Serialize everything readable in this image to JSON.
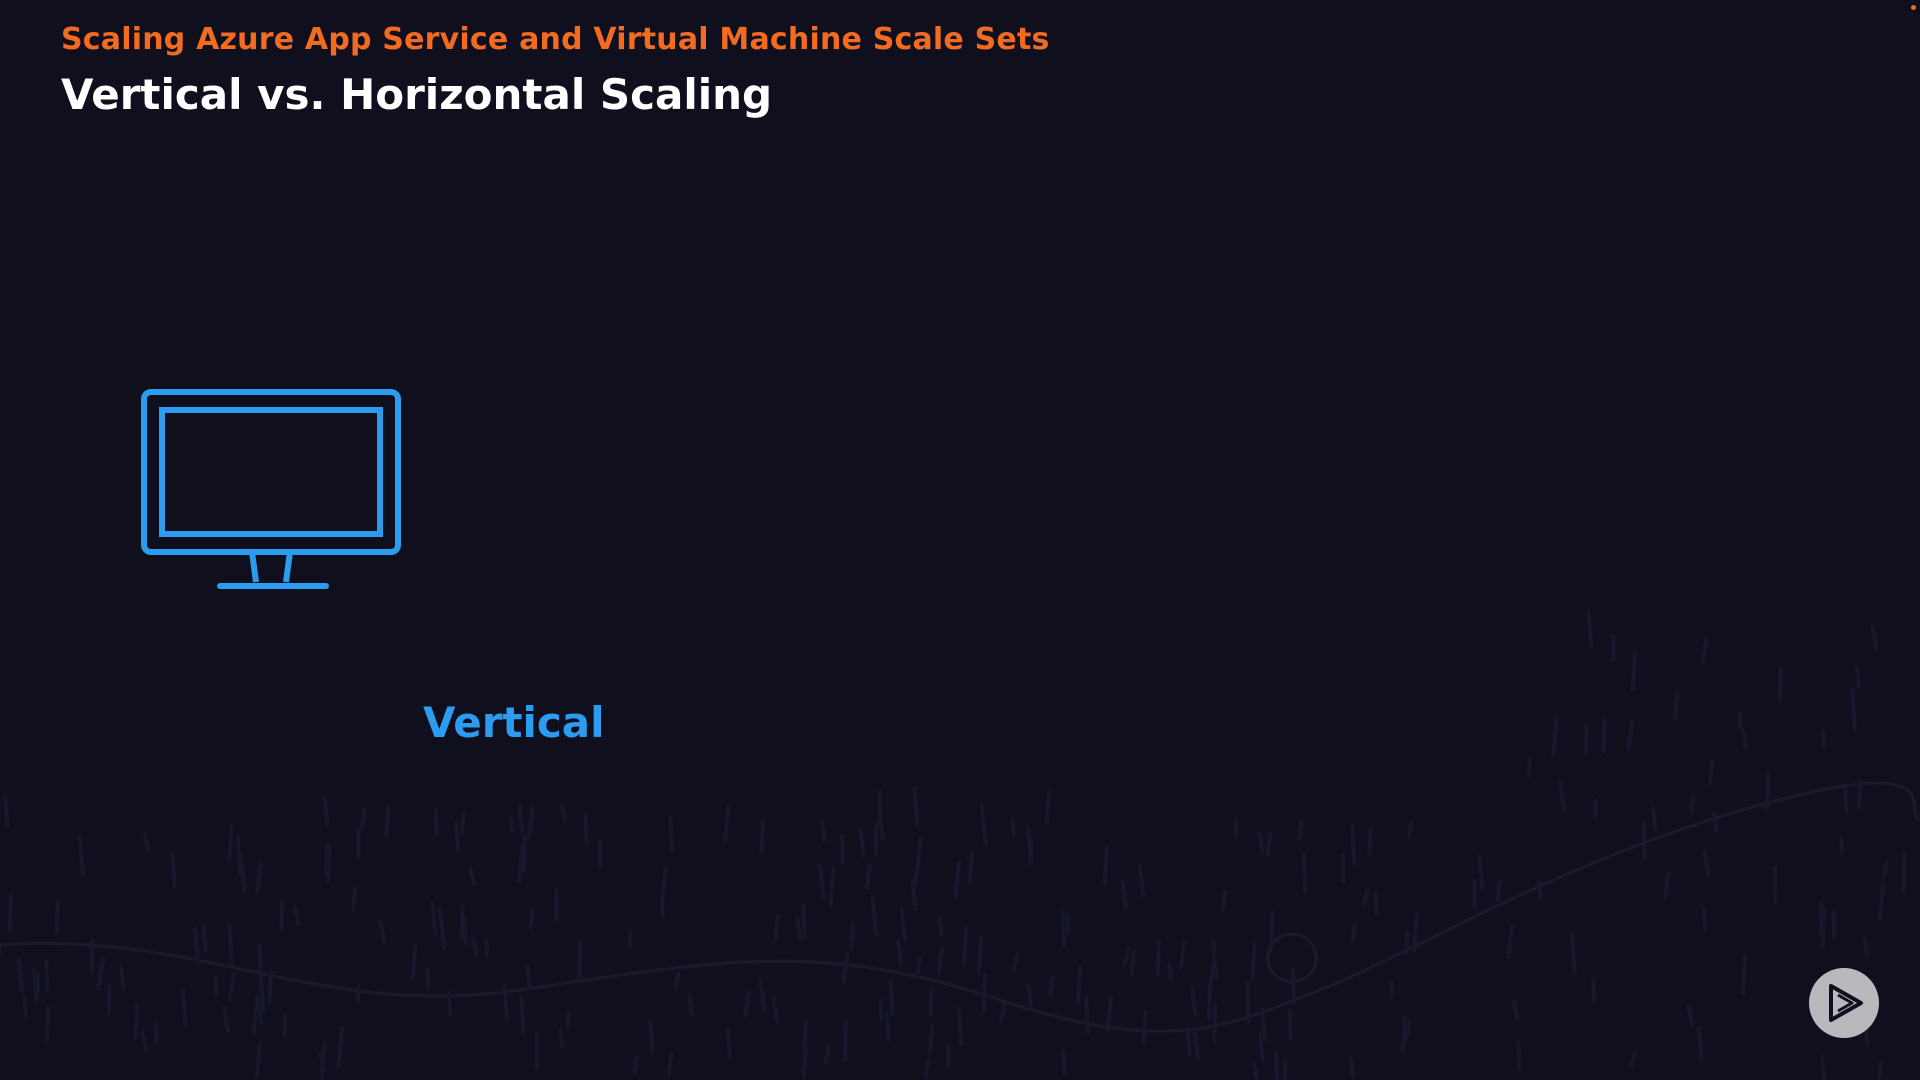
{
  "slide": {
    "course_title": "Scaling Azure App Service and Virtual Machine Scale Sets",
    "title": "Vertical vs. Horizontal Scaling",
    "label": "Vertical"
  },
  "icons": {
    "monitor": "monitor-icon",
    "play": "play-icon"
  },
  "colors": {
    "background": "#0f0f1e",
    "accent_orange": "#f26b21",
    "accent_blue": "#2b9cf0",
    "title_white": "#ffffff"
  }
}
